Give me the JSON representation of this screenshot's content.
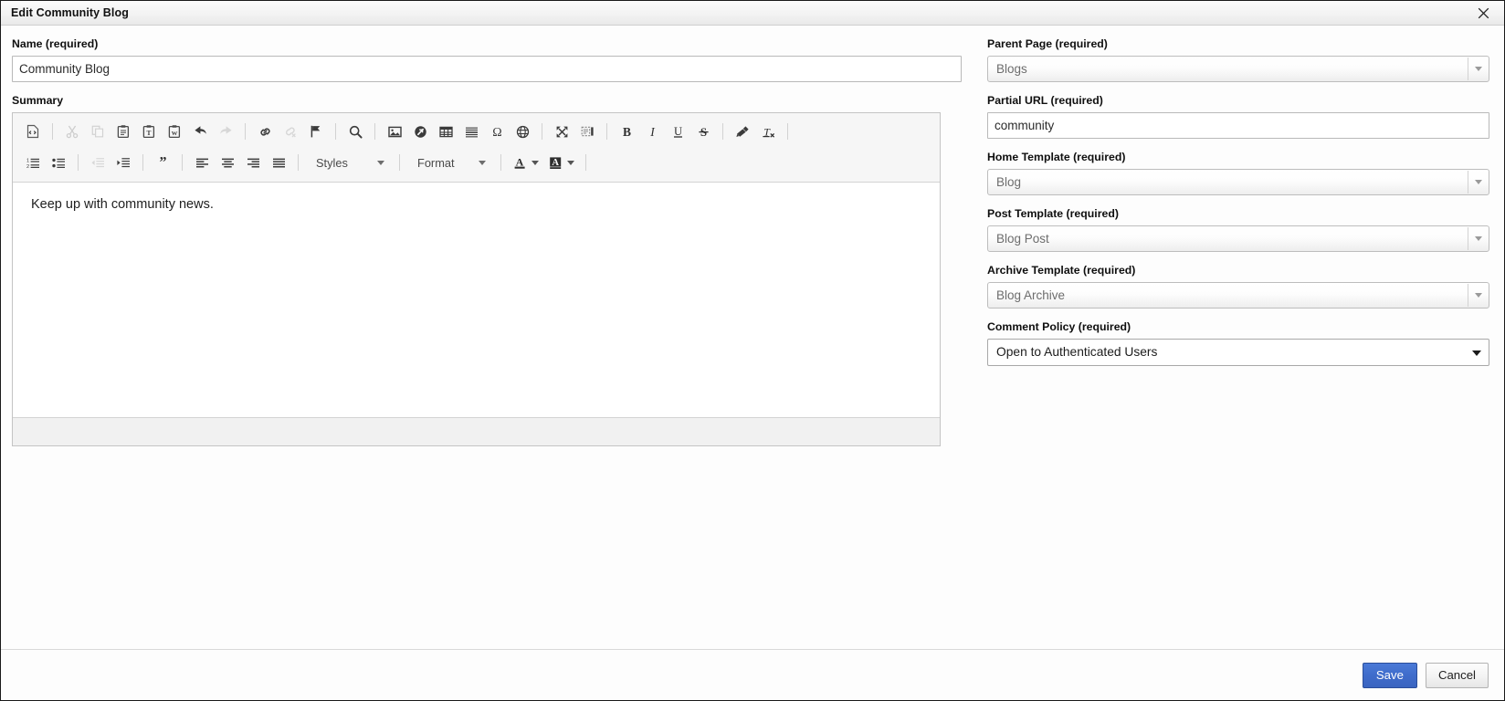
{
  "window": {
    "title": "Edit Community Blog",
    "close_label": "×"
  },
  "left": {
    "name": {
      "label": "Name (required)",
      "value": "Community Blog"
    },
    "summary": {
      "label": "Summary",
      "content": "Keep up with community news."
    }
  },
  "editor": {
    "toolbar_row1": [
      {
        "name": "source-icon",
        "title": "Source",
        "disabled": false
      },
      {
        "name": "separator",
        "title": "",
        "disabled": false
      },
      {
        "name": "cut-icon",
        "title": "Cut",
        "disabled": true
      },
      {
        "name": "copy-icon",
        "title": "Copy",
        "disabled": true
      },
      {
        "name": "paste-icon",
        "title": "Paste",
        "disabled": false
      },
      {
        "name": "paste-text-icon",
        "title": "Paste as plain text",
        "disabled": false
      },
      {
        "name": "paste-from-word-icon",
        "title": "Paste from Word",
        "disabled": false
      },
      {
        "name": "undo-icon",
        "title": "Undo",
        "disabled": false
      },
      {
        "name": "redo-icon",
        "title": "Redo",
        "disabled": true
      },
      {
        "name": "separator",
        "title": "",
        "disabled": false
      },
      {
        "name": "link-icon",
        "title": "Link",
        "disabled": false
      },
      {
        "name": "unlink-icon",
        "title": "Unlink",
        "disabled": true
      },
      {
        "name": "anchor-icon",
        "title": "Anchor",
        "disabled": false
      },
      {
        "name": "separator",
        "title": "",
        "disabled": false
      },
      {
        "name": "search-icon",
        "title": "Find",
        "disabled": false
      },
      {
        "name": "separator",
        "title": "",
        "disabled": false
      },
      {
        "name": "image-icon",
        "title": "Image",
        "disabled": false
      },
      {
        "name": "flash-icon",
        "title": "Flash",
        "disabled": false
      },
      {
        "name": "table-icon",
        "title": "Table",
        "disabled": false
      },
      {
        "name": "horizontal-rule-icon",
        "title": "Horizontal Line",
        "disabled": false
      },
      {
        "name": "special-character-icon",
        "title": "Special Character",
        "disabled": false
      },
      {
        "name": "iframe-icon",
        "title": "IFrame",
        "disabled": false
      },
      {
        "name": "separator",
        "title": "",
        "disabled": false
      },
      {
        "name": "maximize-icon",
        "title": "Maximize",
        "disabled": false
      },
      {
        "name": "show-blocks-icon",
        "title": "Show Blocks",
        "disabled": false
      },
      {
        "name": "separator",
        "title": "",
        "disabled": false
      },
      {
        "name": "bold-icon",
        "title": "Bold",
        "disabled": false
      },
      {
        "name": "italic-icon",
        "title": "Italic",
        "disabled": false
      },
      {
        "name": "underline-icon",
        "title": "Underline",
        "disabled": false
      },
      {
        "name": "strikethrough-icon",
        "title": "Strikethrough",
        "disabled": false
      },
      {
        "name": "separator",
        "title": "",
        "disabled": false
      },
      {
        "name": "copy-formatting-icon",
        "title": "Copy Formatting",
        "disabled": false
      },
      {
        "name": "remove-format-icon",
        "title": "Remove Format",
        "disabled": false
      },
      {
        "name": "separator",
        "title": "",
        "disabled": false
      }
    ],
    "toolbar_row2": [
      {
        "name": "numbered-list-icon",
        "title": "Insert/Remove Numbered List",
        "disabled": false
      },
      {
        "name": "bulleted-list-icon",
        "title": "Insert/Remove Bulleted List",
        "disabled": false
      },
      {
        "name": "separator",
        "title": "",
        "disabled": false
      },
      {
        "name": "outdent-icon",
        "title": "Decrease Indent",
        "disabled": true
      },
      {
        "name": "indent-icon",
        "title": "Increase Indent",
        "disabled": false
      },
      {
        "name": "separator",
        "title": "",
        "disabled": false
      },
      {
        "name": "blockquote-icon",
        "title": "Block Quote",
        "disabled": false
      },
      {
        "name": "separator",
        "title": "",
        "disabled": false
      },
      {
        "name": "align-left-icon",
        "title": "Align Left",
        "disabled": false
      },
      {
        "name": "align-center-icon",
        "title": "Center",
        "disabled": false
      },
      {
        "name": "align-right-icon",
        "title": "Align Right",
        "disabled": false
      },
      {
        "name": "justify-icon",
        "title": "Justify",
        "disabled": false
      },
      {
        "name": "separator",
        "title": "",
        "disabled": false
      }
    ],
    "styles_combo": "Styles",
    "format_combo": "Format",
    "text_color_label": "A",
    "bg_color_label": "A"
  },
  "right": {
    "parent_page": {
      "label": "Parent Page (required)",
      "value": "Blogs",
      "enabled": false
    },
    "partial_url": {
      "label": "Partial URL (required)",
      "value": "community"
    },
    "home_template": {
      "label": "Home Template (required)",
      "value": "Blog",
      "enabled": false
    },
    "post_template": {
      "label": "Post Template (required)",
      "value": "Blog Post",
      "enabled": false
    },
    "archive_template": {
      "label": "Archive Template (required)",
      "value": "Blog Archive",
      "enabled": false
    },
    "comment_policy": {
      "label": "Comment Policy (required)",
      "value": "Open to Authenticated Users",
      "enabled": true
    }
  },
  "footer": {
    "save_label": "Save",
    "cancel_label": "Cancel"
  },
  "colors": {
    "accent": "#3f6ccb",
    "titlebar_text": "#111111",
    "label_text": "#0f0f0f",
    "disabled_select_text": "#6d6d6d"
  }
}
